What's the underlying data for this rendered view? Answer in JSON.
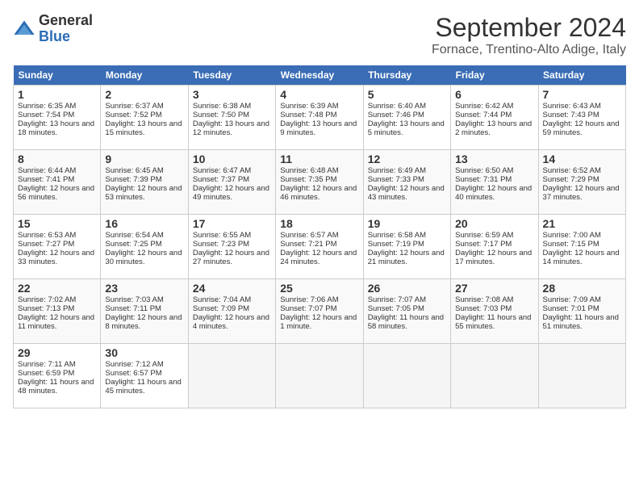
{
  "header": {
    "logo_general": "General",
    "logo_blue": "Blue",
    "title": "September 2024",
    "location": "Fornace, Trentino-Alto Adige, Italy"
  },
  "days_of_week": [
    "Sunday",
    "Monday",
    "Tuesday",
    "Wednesday",
    "Thursday",
    "Friday",
    "Saturday"
  ],
  "weeks": [
    [
      {
        "day": "1",
        "info": "Sunrise: 6:35 AM\nSunset: 7:54 PM\nDaylight: 13 hours and 18 minutes."
      },
      {
        "day": "2",
        "info": "Sunrise: 6:37 AM\nSunset: 7:52 PM\nDaylight: 13 hours and 15 minutes."
      },
      {
        "day": "3",
        "info": "Sunrise: 6:38 AM\nSunset: 7:50 PM\nDaylight: 13 hours and 12 minutes."
      },
      {
        "day": "4",
        "info": "Sunrise: 6:39 AM\nSunset: 7:48 PM\nDaylight: 13 hours and 9 minutes."
      },
      {
        "day": "5",
        "info": "Sunrise: 6:40 AM\nSunset: 7:46 PM\nDaylight: 13 hours and 5 minutes."
      },
      {
        "day": "6",
        "info": "Sunrise: 6:42 AM\nSunset: 7:44 PM\nDaylight: 13 hours and 2 minutes."
      },
      {
        "day": "7",
        "info": "Sunrise: 6:43 AM\nSunset: 7:43 PM\nDaylight: 12 hours and 59 minutes."
      }
    ],
    [
      {
        "day": "8",
        "info": "Sunrise: 6:44 AM\nSunset: 7:41 PM\nDaylight: 12 hours and 56 minutes."
      },
      {
        "day": "9",
        "info": "Sunrise: 6:45 AM\nSunset: 7:39 PM\nDaylight: 12 hours and 53 minutes."
      },
      {
        "day": "10",
        "info": "Sunrise: 6:47 AM\nSunset: 7:37 PM\nDaylight: 12 hours and 49 minutes."
      },
      {
        "day": "11",
        "info": "Sunrise: 6:48 AM\nSunset: 7:35 PM\nDaylight: 12 hours and 46 minutes."
      },
      {
        "day": "12",
        "info": "Sunrise: 6:49 AM\nSunset: 7:33 PM\nDaylight: 12 hours and 43 minutes."
      },
      {
        "day": "13",
        "info": "Sunrise: 6:50 AM\nSunset: 7:31 PM\nDaylight: 12 hours and 40 minutes."
      },
      {
        "day": "14",
        "info": "Sunrise: 6:52 AM\nSunset: 7:29 PM\nDaylight: 12 hours and 37 minutes."
      }
    ],
    [
      {
        "day": "15",
        "info": "Sunrise: 6:53 AM\nSunset: 7:27 PM\nDaylight: 12 hours and 33 minutes."
      },
      {
        "day": "16",
        "info": "Sunrise: 6:54 AM\nSunset: 7:25 PM\nDaylight: 12 hours and 30 minutes."
      },
      {
        "day": "17",
        "info": "Sunrise: 6:55 AM\nSunset: 7:23 PM\nDaylight: 12 hours and 27 minutes."
      },
      {
        "day": "18",
        "info": "Sunrise: 6:57 AM\nSunset: 7:21 PM\nDaylight: 12 hours and 24 minutes."
      },
      {
        "day": "19",
        "info": "Sunrise: 6:58 AM\nSunset: 7:19 PM\nDaylight: 12 hours and 21 minutes."
      },
      {
        "day": "20",
        "info": "Sunrise: 6:59 AM\nSunset: 7:17 PM\nDaylight: 12 hours and 17 minutes."
      },
      {
        "day": "21",
        "info": "Sunrise: 7:00 AM\nSunset: 7:15 PM\nDaylight: 12 hours and 14 minutes."
      }
    ],
    [
      {
        "day": "22",
        "info": "Sunrise: 7:02 AM\nSunset: 7:13 PM\nDaylight: 12 hours and 11 minutes."
      },
      {
        "day": "23",
        "info": "Sunrise: 7:03 AM\nSunset: 7:11 PM\nDaylight: 12 hours and 8 minutes."
      },
      {
        "day": "24",
        "info": "Sunrise: 7:04 AM\nSunset: 7:09 PM\nDaylight: 12 hours and 4 minutes."
      },
      {
        "day": "25",
        "info": "Sunrise: 7:06 AM\nSunset: 7:07 PM\nDaylight: 12 hours and 1 minute."
      },
      {
        "day": "26",
        "info": "Sunrise: 7:07 AM\nSunset: 7:05 PM\nDaylight: 11 hours and 58 minutes."
      },
      {
        "day": "27",
        "info": "Sunrise: 7:08 AM\nSunset: 7:03 PM\nDaylight: 11 hours and 55 minutes."
      },
      {
        "day": "28",
        "info": "Sunrise: 7:09 AM\nSunset: 7:01 PM\nDaylight: 11 hours and 51 minutes."
      }
    ],
    [
      {
        "day": "29",
        "info": "Sunrise: 7:11 AM\nSunset: 6:59 PM\nDaylight: 11 hours and 48 minutes."
      },
      {
        "day": "30",
        "info": "Sunrise: 7:12 AM\nSunset: 6:57 PM\nDaylight: 11 hours and 45 minutes."
      },
      {
        "day": "",
        "info": ""
      },
      {
        "day": "",
        "info": ""
      },
      {
        "day": "",
        "info": ""
      },
      {
        "day": "",
        "info": ""
      },
      {
        "day": "",
        "info": ""
      }
    ]
  ]
}
